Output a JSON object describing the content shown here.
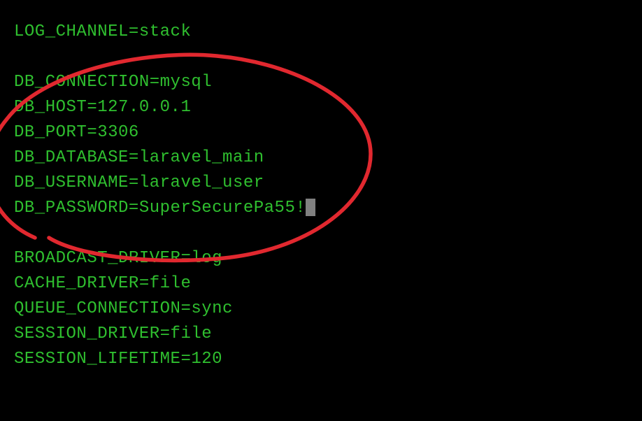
{
  "env": {
    "log_channel": "LOG_CHANNEL=stack",
    "db_connection": "DB_CONNECTION=mysql",
    "db_host": "DB_HOST=127.0.0.1",
    "db_port": "DB_PORT=3306",
    "db_database": "DB_DATABASE=laravel_main",
    "db_username": "DB_USERNAME=laravel_user",
    "db_password": "DB_PASSWORD=SuperSecurePa55!",
    "broadcast_driver": "BROADCAST_DRIVER=log",
    "cache_driver": "CACHE_DRIVER=file",
    "queue_connection": "QUEUE_CONNECTION=sync",
    "session_driver": "SESSION_DRIVER=file",
    "session_lifetime": "SESSION_LIFETIME=120"
  },
  "annotation": {
    "kind": "ellipse-circle",
    "color": "#e1282f"
  }
}
